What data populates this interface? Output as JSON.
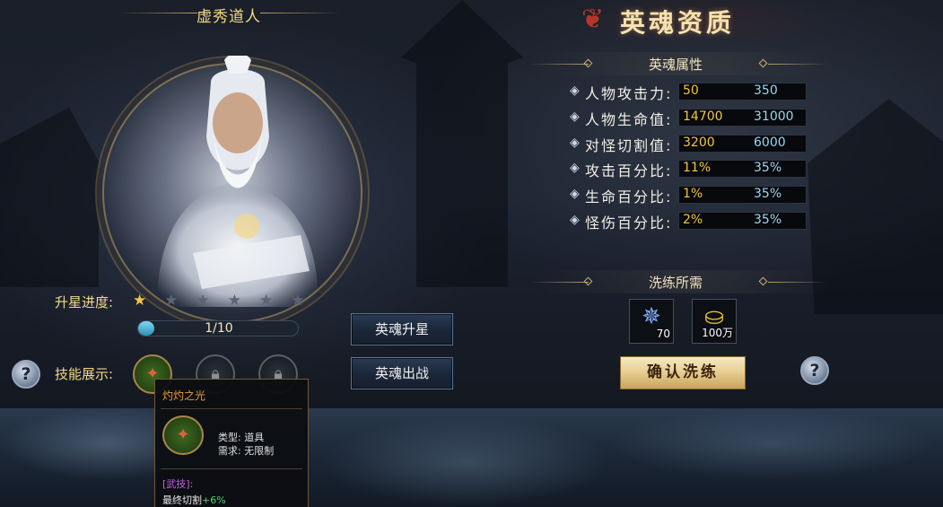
{
  "hero": {
    "name": "虚秀道人",
    "star_label": "升星进度:",
    "stars": [
      "★",
      "★",
      "★",
      "★",
      "★",
      "★"
    ],
    "stars_filled": 1,
    "progress_text": "1/10",
    "progress_fraction": 0.1,
    "skill_label": "技能展示:",
    "skill_icons": [
      "skill-icon",
      "lock-icon",
      "lock-icon"
    ]
  },
  "buttons": {
    "star_up": "英魂升星",
    "battle": "英魂出战",
    "confirm": "确认洗练",
    "help": "?"
  },
  "tooltip": {
    "title": "灼灼之光",
    "type": "类型: 道具",
    "requirement": "需求: 无限制",
    "tag": "[武技]:",
    "effect": "最终切割",
    "effect_value": "+6%"
  },
  "panel": {
    "title": "英魂资质",
    "attr_section": "英魂属性",
    "wash_section": "洗练所需"
  },
  "attributes": [
    {
      "name": "人物攻击力:",
      "current": "50",
      "max": "350"
    },
    {
      "name": "人物生命值:",
      "current": "14700",
      "max": "31000"
    },
    {
      "name": "对怪切割值:",
      "current": "3200",
      "max": "6000"
    },
    {
      "name": "攻击百分比:",
      "current": "11%",
      "max": "35%"
    },
    {
      "name": "生命百分比:",
      "current": "1%",
      "max": "35%"
    },
    {
      "name": "怪伤百分比:",
      "current": "2%",
      "max": "35%"
    }
  ],
  "costs": [
    {
      "icon": "crystal-icon",
      "amount": "70"
    },
    {
      "icon": "gold-ingot-icon",
      "amount": "100万"
    }
  ],
  "colors": {
    "gold_text": "#f2d98a",
    "current_value": "#f2c63a",
    "max_value": "#9ad6f0",
    "tooltip_title": "#e89a3a",
    "tooltip_tag": "#c060e0",
    "tooltip_bonus": "#49d66a"
  }
}
